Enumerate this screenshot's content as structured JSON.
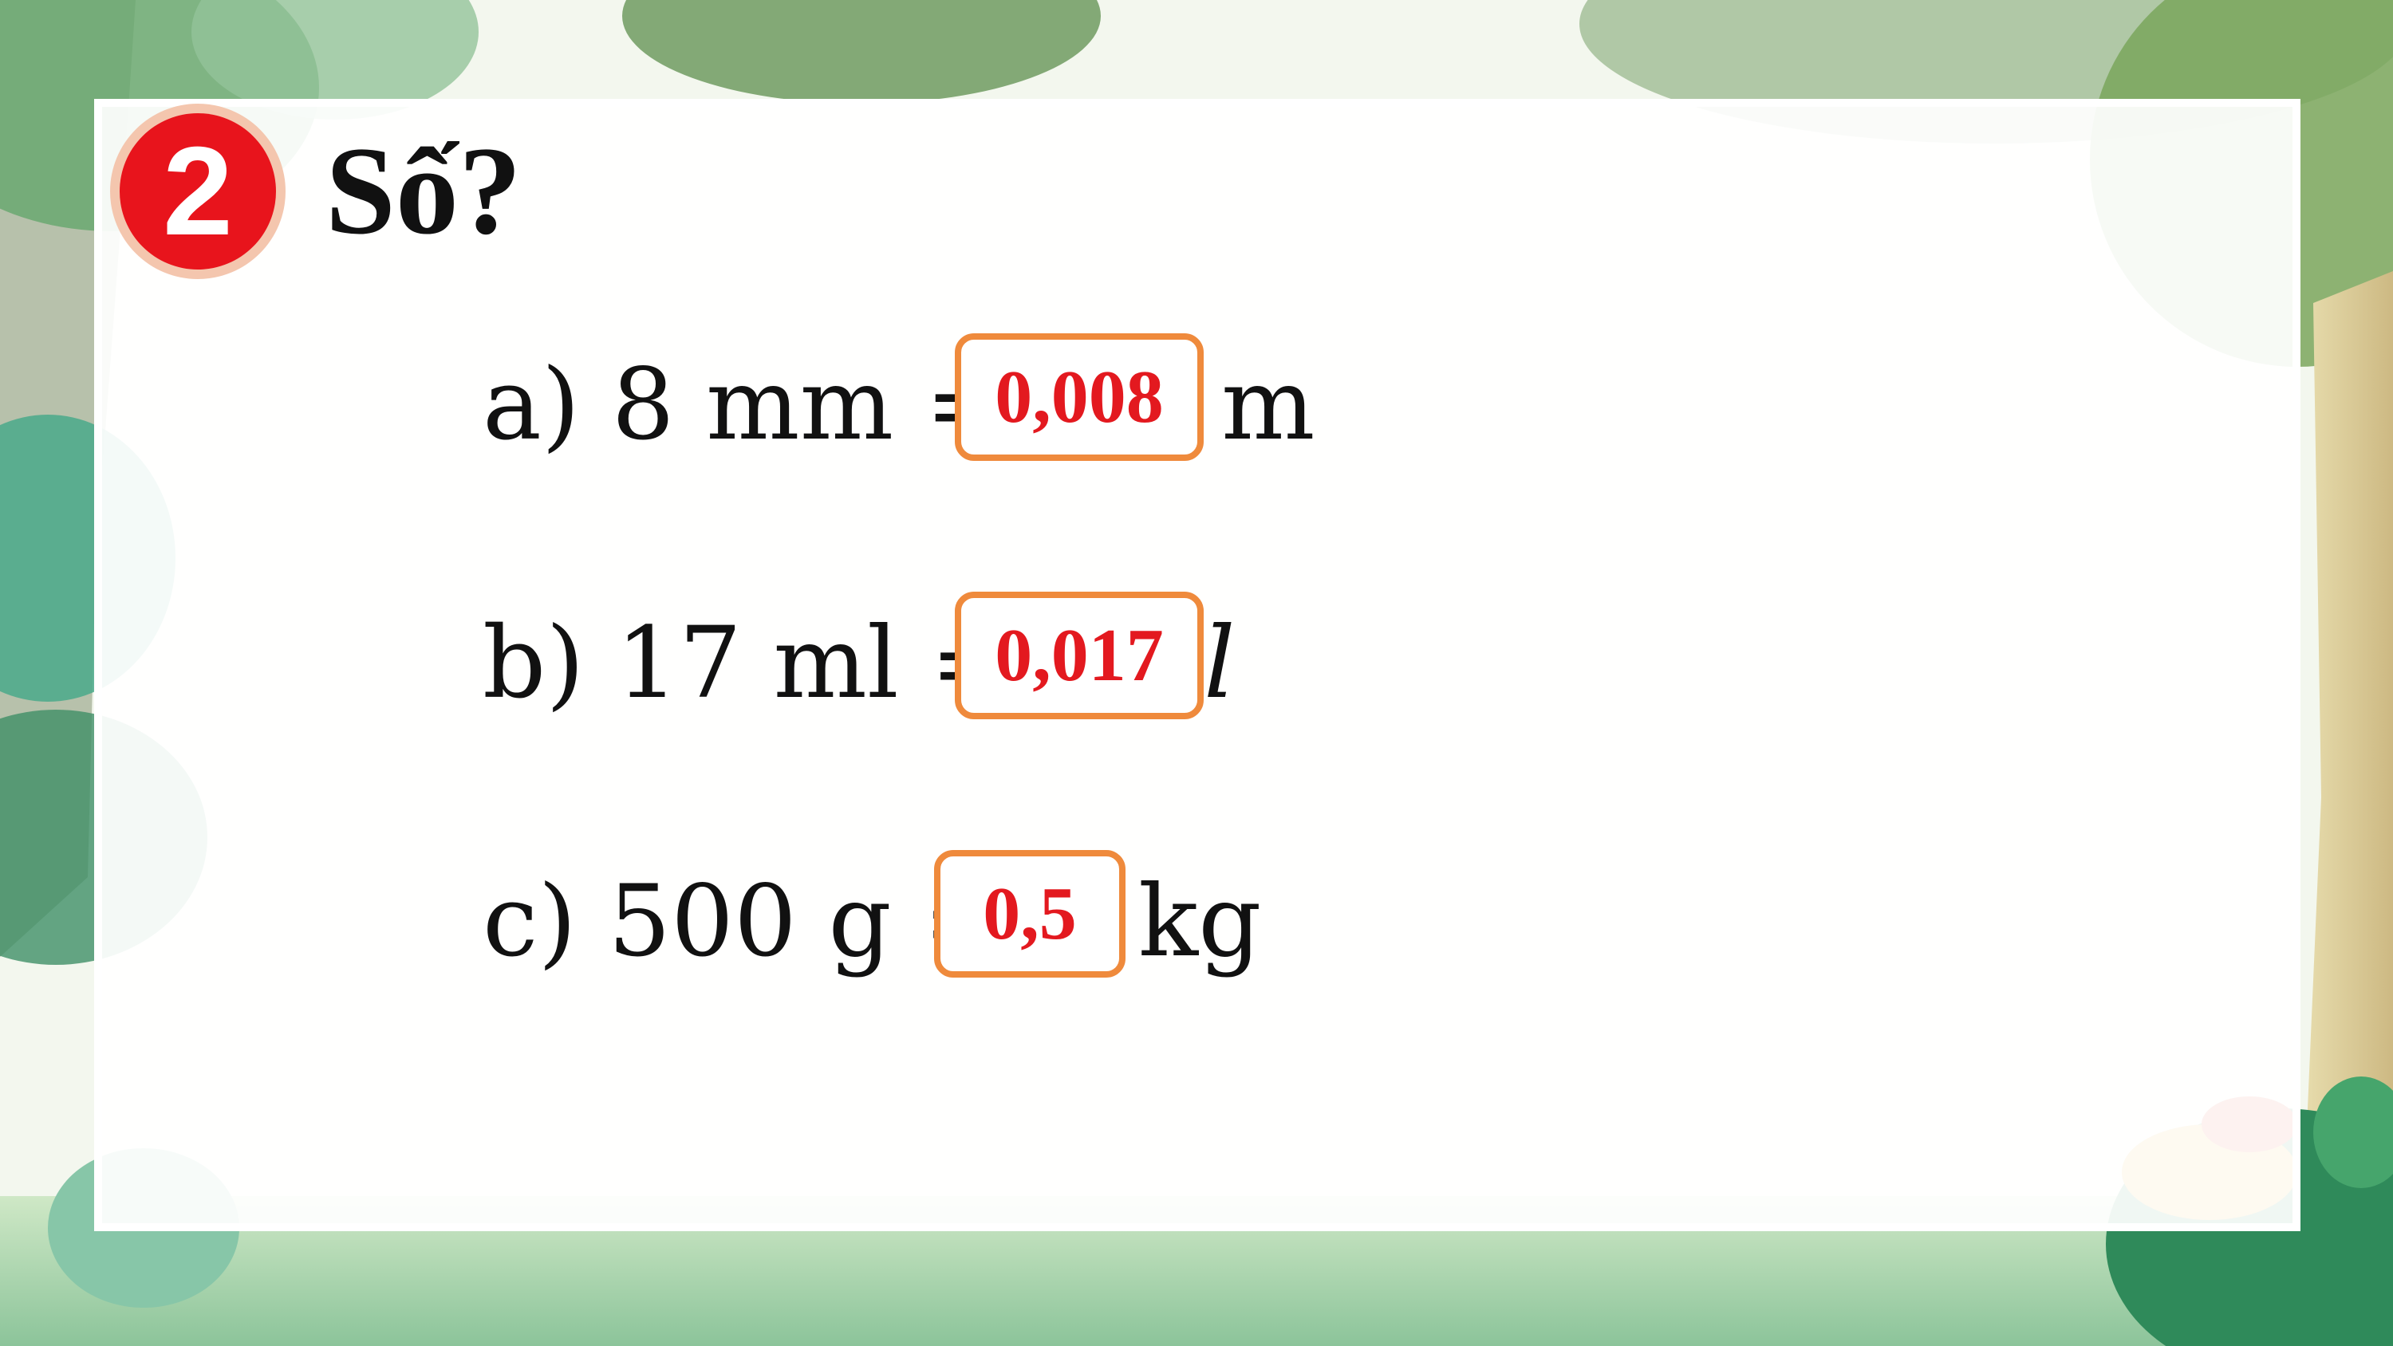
{
  "exercise": {
    "number": "2",
    "title": "Số?"
  },
  "items": [
    {
      "label": "a) 8 mm =",
      "answer": "0,008",
      "unit": "m"
    },
    {
      "label": "b) 17 ml =",
      "answer": "0,017",
      "unit": "l"
    },
    {
      "label": "c) 500 g =",
      "answer": "0,5",
      "unit": "kg"
    }
  ],
  "colors": {
    "badge": "#e8141c",
    "answer_text": "#e3191f",
    "box_border": "#ef8a3c",
    "foliage": "#5a9a4a"
  },
  "decorations": [
    "tree-foliage",
    "tree-trunk",
    "leaves",
    "flower"
  ]
}
